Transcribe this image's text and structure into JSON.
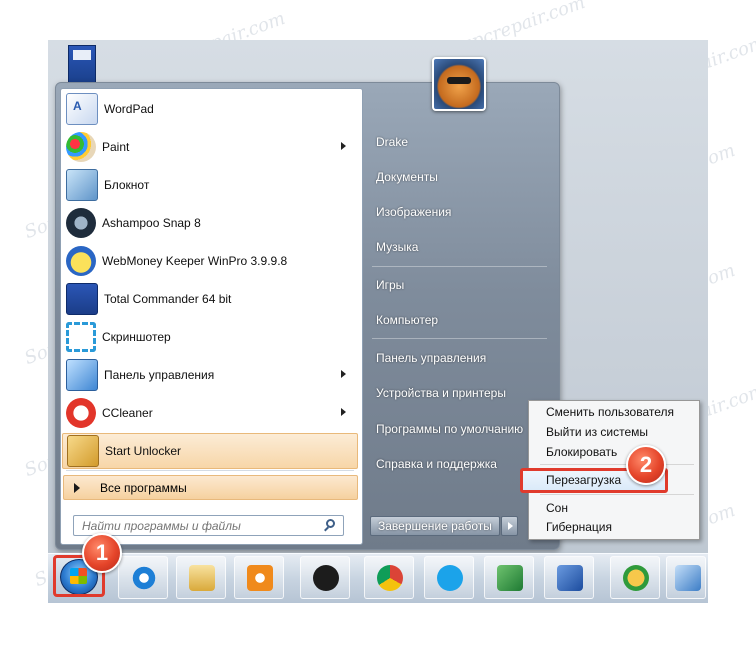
{
  "watermark": "Soringpcrepair.com",
  "start_menu": {
    "programs": [
      {
        "label": "WordPad",
        "icon": "wordpad-icon",
        "has_submenu": false
      },
      {
        "label": "Paint",
        "icon": "paint-icon",
        "has_submenu": true
      },
      {
        "label": "Блокнот",
        "icon": "notepad-icon",
        "has_submenu": false
      },
      {
        "label": "Ashampoo Snap 8",
        "icon": "ashampoo-snap-icon",
        "has_submenu": false
      },
      {
        "label": "WebMoney Keeper WinPro 3.9.9.8",
        "icon": "webmoney-icon",
        "has_submenu": false
      },
      {
        "label": "Total Commander 64 bit",
        "icon": "total-commander-icon",
        "has_submenu": false
      },
      {
        "label": "Скриншотер",
        "icon": "screenshoter-icon",
        "has_submenu": false
      },
      {
        "label": "Панель управления",
        "icon": "control-panel-icon",
        "has_submenu": true
      },
      {
        "label": "CCleaner",
        "icon": "ccleaner-icon",
        "has_submenu": true
      },
      {
        "label": "Start Unlocker",
        "icon": "start-unlocker-icon",
        "has_submenu": false,
        "highlighted": true
      }
    ],
    "all_programs_label": "Все программы",
    "search_placeholder": "Найти программы и файлы",
    "right_items": [
      "Drake",
      "Документы",
      "Изображения",
      "Музыка",
      "Игры",
      "Компьютер",
      "Панель управления",
      "Устройства и принтеры",
      "Программы по умолчанию",
      "Справка и поддержка"
    ],
    "shutdown_label": "Завершение работы"
  },
  "context_menu": {
    "items": [
      "Сменить пользователя",
      "Выйти из системы",
      "Блокировать",
      "Перезагрузка",
      "Сон",
      "Гибернация"
    ],
    "highlighted_index": 3
  },
  "callouts": {
    "start": "1",
    "restart": "2"
  },
  "taskbar": {
    "apps": [
      "internet-explorer-icon",
      "file-explorer-icon",
      "media-player-icon",
      "hp-icon",
      "chrome-icon",
      "skype-icon",
      "excel-icon",
      "word-icon",
      "network-globe-icon",
      "app-icon"
    ]
  },
  "colors": {
    "callout_red": "#e03a2c",
    "menu_hover": "#f7d6a8"
  }
}
